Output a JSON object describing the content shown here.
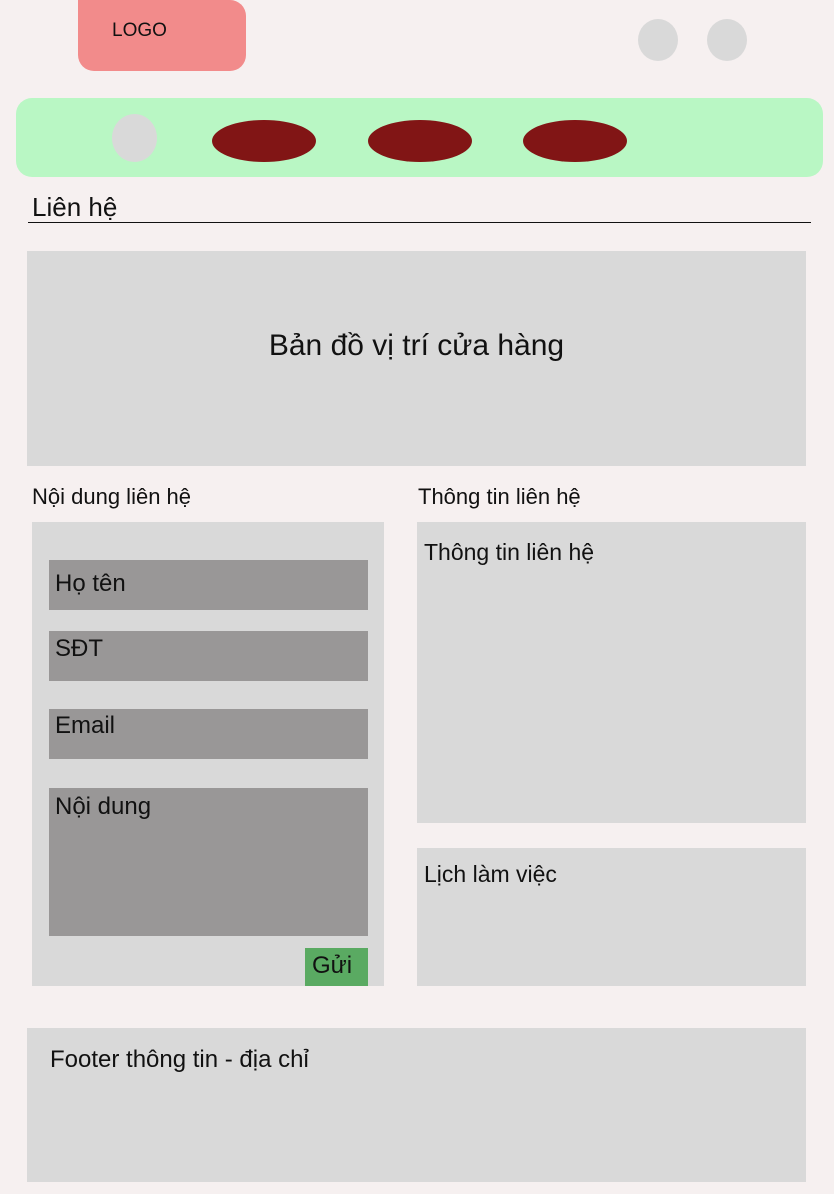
{
  "header": {
    "logo": "LOGO"
  },
  "page": {
    "title": "Liên hệ"
  },
  "map": {
    "label": "Bản đồ vị trí cửa hàng"
  },
  "form": {
    "section_title": "Nội dung liên hệ",
    "name_placeholder": "Họ tên",
    "phone_placeholder": "SĐT",
    "email_placeholder": "Email",
    "message_placeholder": "Nội dung",
    "send_label": "Gửi"
  },
  "contact_info": {
    "section_title": "Thông tin liên hệ",
    "box_label": "Thông tin liên hệ",
    "schedule_label": "Lịch làm việc"
  },
  "footer": {
    "label": "Footer thông tin - địa chỉ"
  },
  "colors": {
    "logo": "#f28b8b",
    "nav": "#b9f7c4",
    "nav_item": "#811515",
    "send_button": "#5aaa62"
  }
}
